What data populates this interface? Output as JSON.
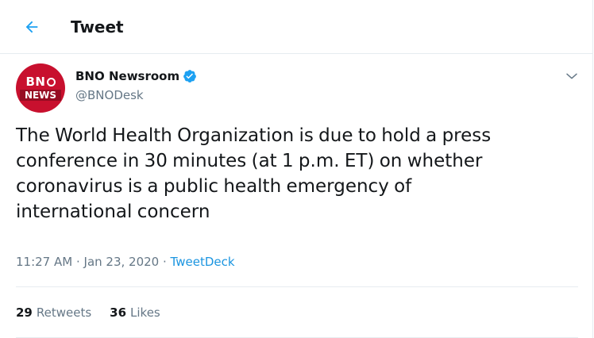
{
  "header": {
    "title": "Tweet",
    "back_icon": "arrow-left-icon"
  },
  "author": {
    "avatar_line1": "BNO",
    "avatar_line2": "NEWS",
    "name": "BNO Newsroom",
    "handle": "@BNODesk",
    "verified": true
  },
  "tweet": {
    "text": "The World Health Organization is due to hold a press\nconference in 30 minutes (at 1 p.m. ET) on whether\ncoronavirus is a public health emergency of\ninternational concern",
    "time": "11:27 AM",
    "date": "Jan 23, 2020",
    "separator": "·",
    "source": "TweetDeck"
  },
  "stats": {
    "retweets_count": "29",
    "retweets_label": "Retweets",
    "likes_count": "36",
    "likes_label": "Likes"
  },
  "colors": {
    "accent": "#1da1f2",
    "link": "#1b95e0",
    "secondary_text": "#657786",
    "primary_text": "#14171a",
    "border": "#e6ecf0",
    "avatar_red": "#c8102e"
  }
}
